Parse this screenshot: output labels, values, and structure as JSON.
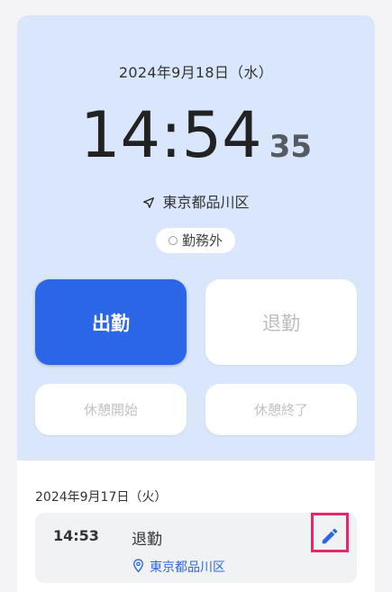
{
  "clock": {
    "date": "2024年9月18日（水）",
    "time_hm": "14:54",
    "time_sec": "35",
    "location": "東京都品川区",
    "status": "勤務外"
  },
  "actions": {
    "clock_in": "出勤",
    "clock_out": "退勤",
    "break_start": "休憩開始",
    "break_end": "休憩終了"
  },
  "history": {
    "date": "2024年9月17日（火）",
    "records": [
      {
        "time": "14:53",
        "type": "退勤",
        "location": "東京都品川区"
      }
    ]
  },
  "icons": {
    "location_arrow": "navigation-arrow-icon",
    "status_circle": "circle-icon",
    "map_pin": "map-pin-icon",
    "edit": "pencil-icon"
  },
  "colors": {
    "accent": "#2b66e8",
    "panel": "#d9e6fb",
    "highlight": "#e8266f"
  }
}
